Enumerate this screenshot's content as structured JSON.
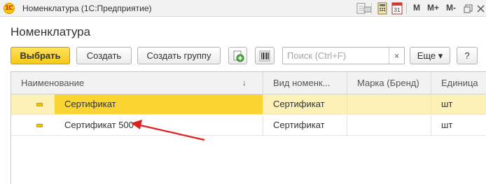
{
  "window": {
    "app_logo_text": "1С",
    "title": "Номенклатура  (1С:Предприятие)",
    "toolbar": {
      "m_label": "M",
      "m_plus_label": "M+",
      "m_minus_label": "M-",
      "calendar_day": "31"
    }
  },
  "form": {
    "title": "Номенклатура"
  },
  "commandbar": {
    "select_label": "Выбрать",
    "create_label": "Создать",
    "create_group_label": "Создать группу",
    "search_placeholder": "Поиск (Ctrl+F)",
    "search_clear": "×",
    "more_label": "Еще ▾",
    "help_label": "?"
  },
  "table": {
    "columns": [
      {
        "label": "Наименование"
      },
      {
        "label": "Вид номенк..."
      },
      {
        "label": "Марка (Бренд)"
      },
      {
        "label": "Единица"
      }
    ],
    "sort_indicator": "↓",
    "rows": [
      {
        "name": "Сертификат",
        "kind": "Сертификат",
        "brand": "",
        "unit": "шт",
        "selected": true
      },
      {
        "name": "Сертификат 500",
        "kind": "Сертификат",
        "brand": "",
        "unit": "шт",
        "selected": false
      }
    ]
  },
  "colors": {
    "primary_button": "#f5c918",
    "selected_row": "#fdf1b7",
    "current_cell": "#f9d432",
    "annotation_arrow": "#e02020"
  }
}
